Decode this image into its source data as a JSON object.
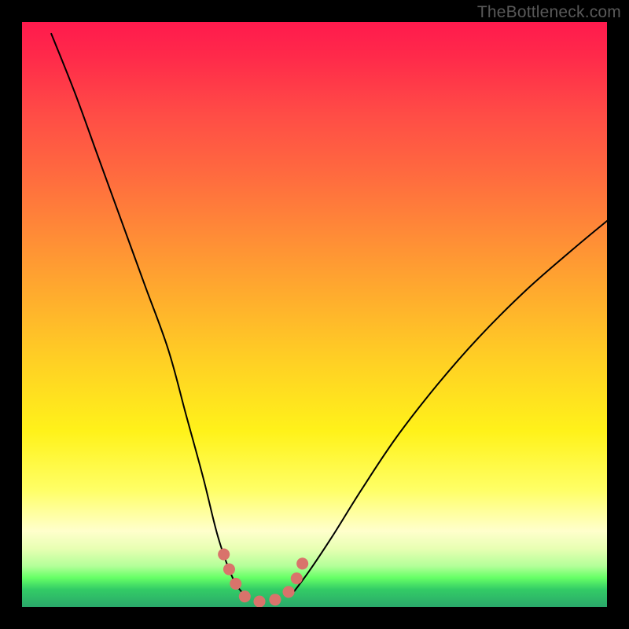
{
  "watermark": "TheBottleneck.com",
  "chart_data": {
    "type": "line",
    "title": "",
    "xlabel": "",
    "ylabel": "",
    "xlim": [
      0,
      100
    ],
    "ylim": [
      0,
      100
    ],
    "grid": false,
    "legend": false,
    "series": [
      {
        "name": "left-curve",
        "color": "#000000",
        "x": [
          5,
          9,
          13,
          17,
          21,
          25,
          28,
          31,
          33.5,
          36,
          38
        ],
        "values": [
          98,
          88,
          77,
          66,
          55,
          44,
          33,
          22,
          12,
          5,
          2
        ]
      },
      {
        "name": "right-curve",
        "color": "#000000",
        "x": [
          46,
          49,
          53,
          58,
          64,
          71,
          78,
          86,
          94,
          100
        ],
        "values": [
          2,
          6,
          12,
          20,
          29,
          38,
          46,
          54,
          61,
          66
        ]
      },
      {
        "name": "valley-highlight",
        "color": "#d9736b",
        "x": [
          34.5,
          36,
          37.5,
          38.5,
          40,
          42,
          44,
          45.5,
          47,
          48.5
        ],
        "values": [
          9,
          5,
          2.5,
          1.5,
          1,
          1,
          1.5,
          2.5,
          5,
          9
        ]
      }
    ],
    "background_gradient": {
      "stops": [
        {
          "pos": 0,
          "color": "#ff1a4d"
        },
        {
          "pos": 26,
          "color": "#ff6a3f"
        },
        {
          "pos": 58,
          "color": "#ffd024"
        },
        {
          "pos": 80,
          "color": "#ffff66"
        },
        {
          "pos": 93,
          "color": "#b3ff99"
        },
        {
          "pos": 100,
          "color": "#2aa86a"
        }
      ]
    }
  }
}
